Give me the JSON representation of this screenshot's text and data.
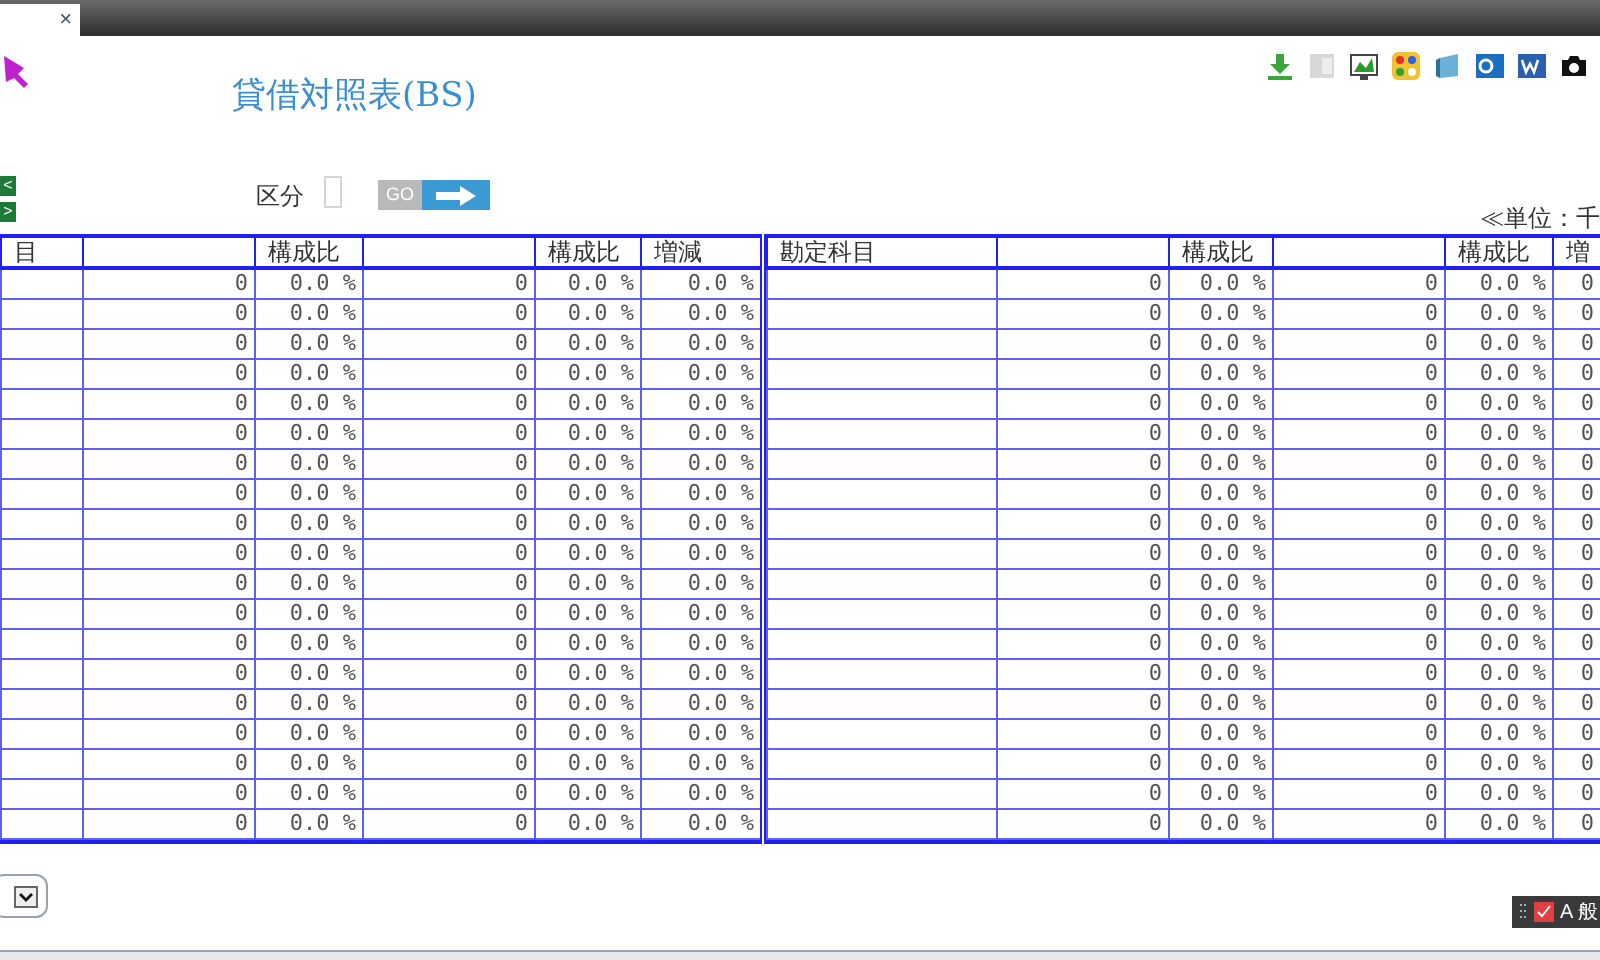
{
  "browser_tab": {
    "close": "×"
  },
  "title": "貸借対照表(BS)",
  "nav_buttons": [
    "<",
    ">"
  ],
  "filter": {
    "label": "区分",
    "go": "GO"
  },
  "unit": "≪単位：千",
  "left_table": {
    "columns": [
      "目",
      "",
      "構成比",
      "",
      "構成比",
      "増減"
    ],
    "rows": [
      {
        "cells": [
          "",
          "0",
          "0.0 %",
          "0",
          "0.0 %",
          "0.0 %"
        ]
      },
      {
        "cells": [
          "",
          "0",
          "0.0 %",
          "0",
          "0.0 %",
          "0.0 %"
        ]
      },
      {
        "cells": [
          "",
          "0",
          "0.0 %",
          "0",
          "0.0 %",
          "0.0 %"
        ]
      },
      {
        "cells": [
          "",
          "0",
          "0.0 %",
          "0",
          "0.0 %",
          "0.0 %"
        ]
      },
      {
        "cells": [
          "",
          "0",
          "0.0 %",
          "0",
          "0.0 %",
          "0.0 %"
        ]
      },
      {
        "cells": [
          "",
          "0",
          "0.0 %",
          "0",
          "0.0 %",
          "0.0 %"
        ]
      },
      {
        "cells": [
          "",
          "0",
          "0.0 %",
          "0",
          "0.0 %",
          "0.0 %"
        ]
      },
      {
        "cells": [
          "",
          "0",
          "0.0 %",
          "0",
          "0.0 %",
          "0.0 %"
        ]
      },
      {
        "cells": [
          "",
          "0",
          "0.0 %",
          "0",
          "0.0 %",
          "0.0 %"
        ]
      },
      {
        "cells": [
          "",
          "0",
          "0.0 %",
          "0",
          "0.0 %",
          "0.0 %"
        ]
      },
      {
        "cells": [
          "",
          "0",
          "0.0 %",
          "0",
          "0.0 %",
          "0.0 %"
        ]
      },
      {
        "cells": [
          "",
          "0",
          "0.0 %",
          "0",
          "0.0 %",
          "0.0 %"
        ]
      },
      {
        "cells": [
          "",
          "0",
          "0.0 %",
          "0",
          "0.0 %",
          "0.0 %"
        ]
      },
      {
        "cells": [
          "",
          "0",
          "0.0 %",
          "0",
          "0.0 %",
          "0.0 %"
        ]
      },
      {
        "cells": [
          "",
          "0",
          "0.0 %",
          "0",
          "0.0 %",
          "0.0 %"
        ]
      },
      {
        "cells": [
          "",
          "0",
          "0.0 %",
          "0",
          "0.0 %",
          "0.0 %"
        ]
      },
      {
        "cells": [
          "",
          "0",
          "0.0 %",
          "0",
          "0.0 %",
          "0.0 %"
        ]
      },
      {
        "cells": [
          "",
          "0",
          "0.0 %",
          "0",
          "0.0 %",
          "0.0 %"
        ]
      },
      {
        "cells": [
          "",
          "0",
          "0.0 %",
          "0",
          "0.0 %",
          "0.0 %"
        ]
      }
    ]
  },
  "right_table": {
    "columns": [
      "勘定科目",
      "",
      "構成比",
      "",
      "構成比",
      "増"
    ],
    "rows": [
      {
        "cells": [
          "",
          "0",
          "0.0 %",
          "0",
          "0.0 %",
          "0"
        ]
      },
      {
        "cells": [
          "",
          "0",
          "0.0 %",
          "0",
          "0.0 %",
          "0"
        ]
      },
      {
        "cells": [
          "",
          "0",
          "0.0 %",
          "0",
          "0.0 %",
          "0"
        ]
      },
      {
        "cells": [
          "",
          "0",
          "0.0 %",
          "0",
          "0.0 %",
          "0"
        ]
      },
      {
        "cells": [
          "",
          "0",
          "0.0 %",
          "0",
          "0.0 %",
          "0"
        ]
      },
      {
        "cells": [
          "",
          "0",
          "0.0 %",
          "0",
          "0.0 %",
          "0"
        ]
      },
      {
        "cells": [
          "",
          "0",
          "0.0 %",
          "0",
          "0.0 %",
          "0"
        ]
      },
      {
        "cells": [
          "",
          "0",
          "0.0 %",
          "0",
          "0.0 %",
          "0"
        ]
      },
      {
        "cells": [
          "",
          "0",
          "0.0 %",
          "0",
          "0.0 %",
          "0"
        ]
      },
      {
        "cells": [
          "",
          "0",
          "0.0 %",
          "0",
          "0.0 %",
          "0"
        ]
      },
      {
        "cells": [
          "",
          "0",
          "0.0 %",
          "0",
          "0.0 %",
          "0"
        ]
      },
      {
        "cells": [
          "",
          "0",
          "0.0 %",
          "0",
          "0.0 %",
          "0"
        ]
      },
      {
        "cells": [
          "",
          "0",
          "0.0 %",
          "0",
          "0.0 %",
          "0"
        ]
      },
      {
        "cells": [
          "",
          "0",
          "0.0 %",
          "0",
          "0.0 %",
          "0"
        ]
      },
      {
        "cells": [
          "",
          "0",
          "0.0 %",
          "0",
          "0.0 %",
          "0"
        ]
      },
      {
        "cells": [
          "",
          "0",
          "0.0 %",
          "0",
          "0.0 %",
          "0"
        ]
      },
      {
        "cells": [
          "",
          "0",
          "0.0 %",
          "0",
          "0.0 %",
          "0"
        ]
      },
      {
        "cells": [
          "",
          "0",
          "0.0 %",
          "0",
          "0.0 %",
          "0"
        ]
      },
      {
        "cells": [
          "",
          "0",
          "0.0 %",
          "0",
          "0.0 %",
          "0"
        ]
      }
    ]
  },
  "ime_bar": {
    "label": "A 般"
  }
}
